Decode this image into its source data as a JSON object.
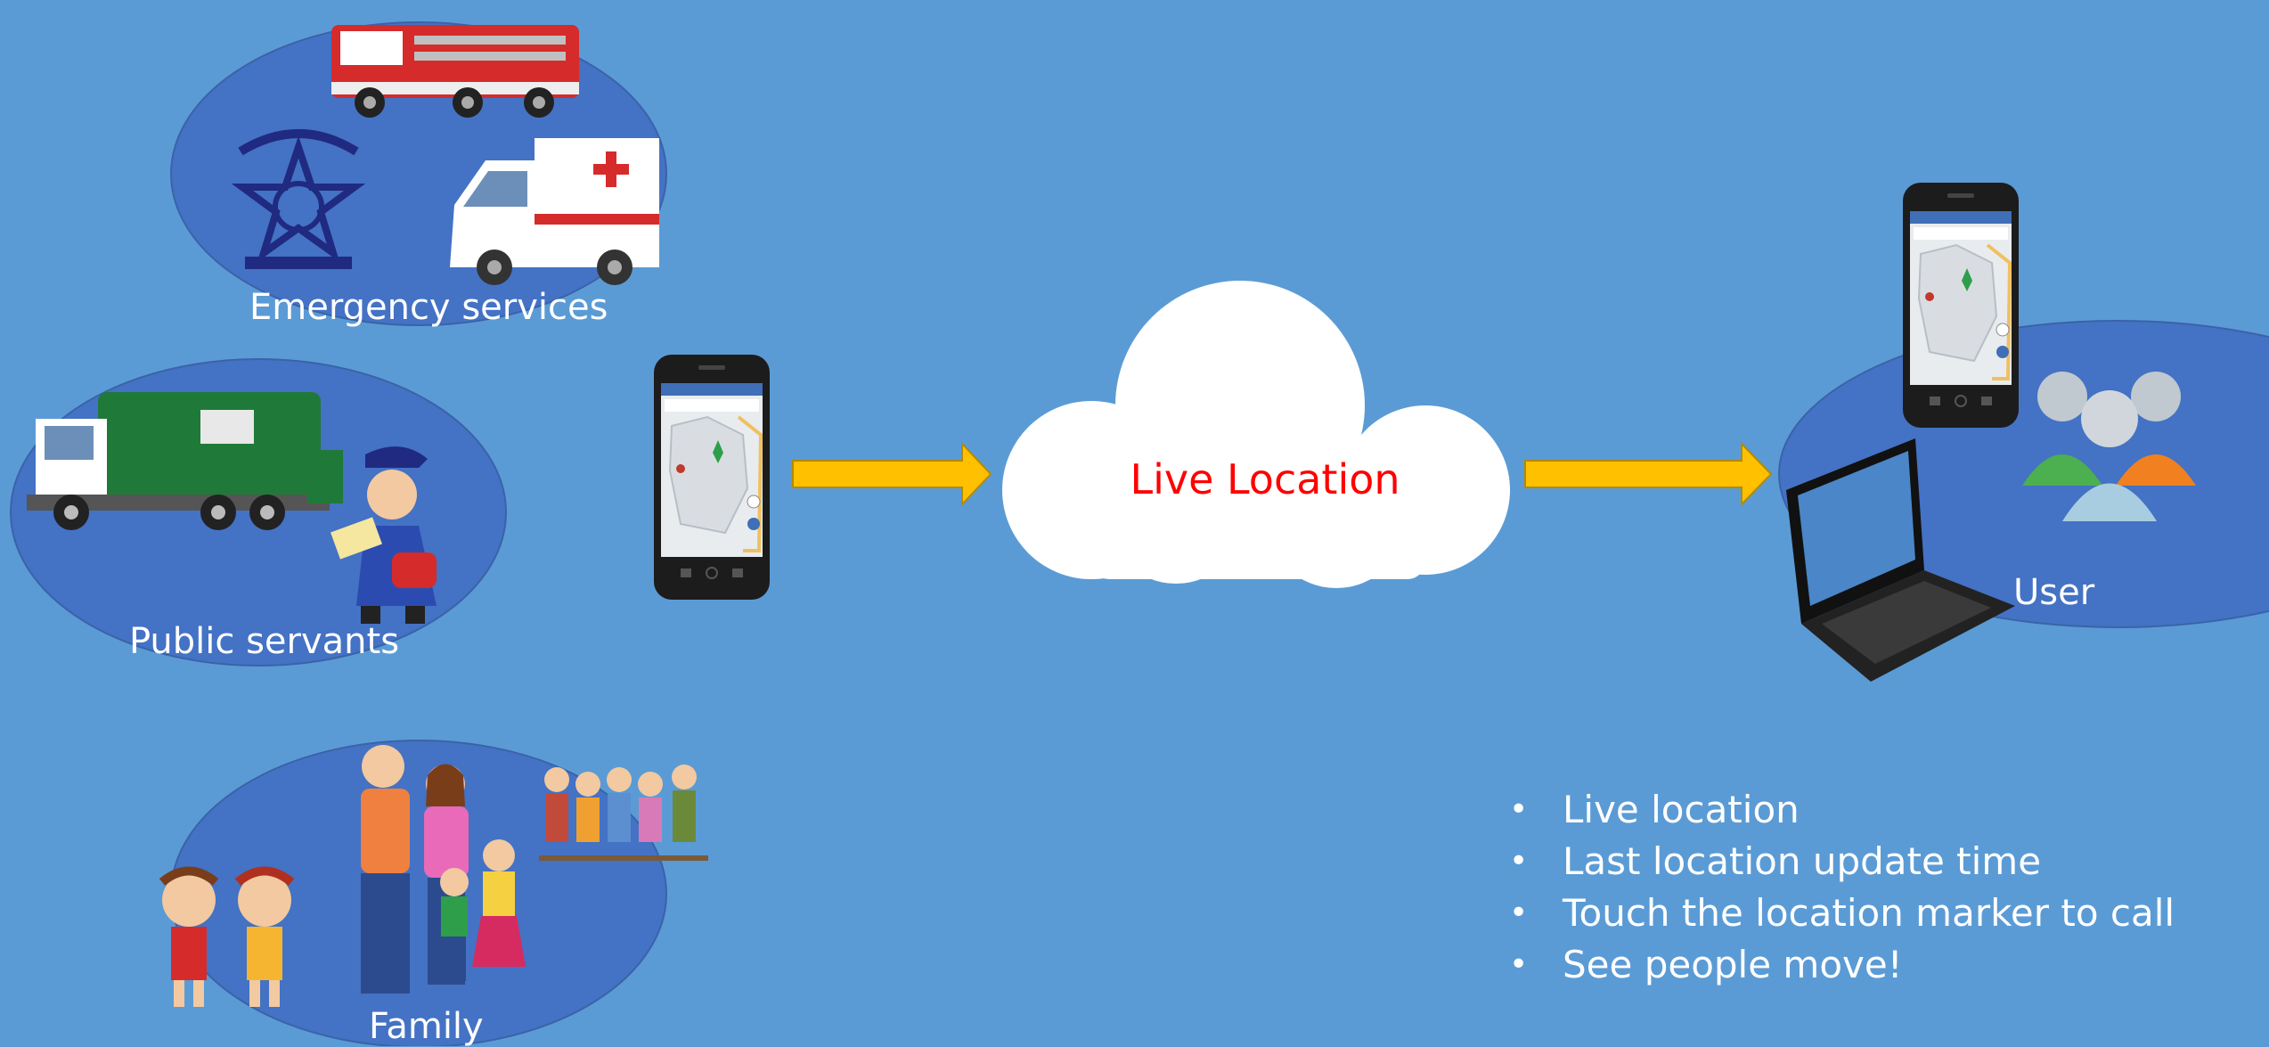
{
  "colors": {
    "background": "#5b9bd5",
    "ellipse": "#4472c4",
    "arrow": "#ffc000",
    "cloud": "#ffffff",
    "cloud_text": "#ff0000",
    "label_text": "#ffffff"
  },
  "groups": {
    "emergency": {
      "label": "Emergency services",
      "icons": [
        "fire-truck-icon",
        "ambulance-icon",
        "police-badge-icon"
      ]
    },
    "public": {
      "label": "Public servants",
      "icons": [
        "garbage-truck-icon",
        "mail-carrier-icon"
      ]
    },
    "family": {
      "label": "Family",
      "icons": [
        "children-icon",
        "parents-icon",
        "elderly-group-icon"
      ]
    },
    "user": {
      "label": "User",
      "icons": [
        "smartphone-icon",
        "laptop-icon",
        "user-group-icon"
      ]
    }
  },
  "cloud": {
    "label": "Live Location",
    "icon": "cloud-icon"
  },
  "features": [
    "Live location",
    "Last location update time",
    "Touch the location marker to call",
    "See people move!"
  ]
}
